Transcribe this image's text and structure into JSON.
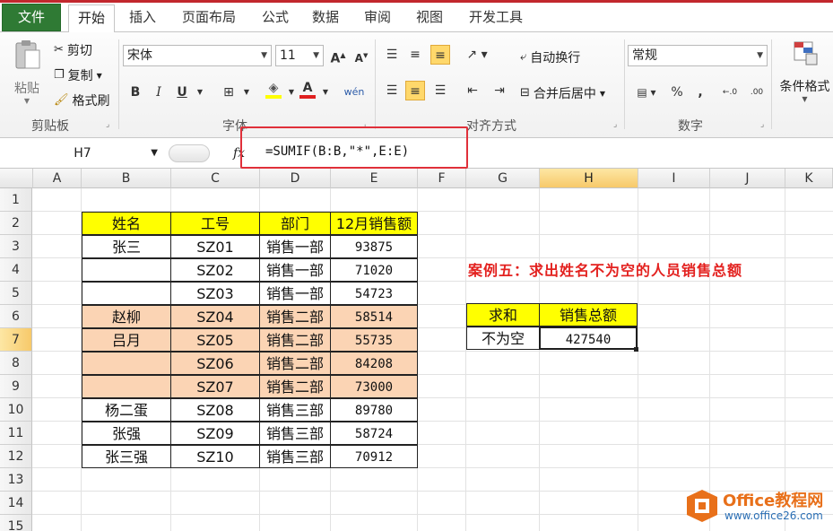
{
  "tabs": [
    "文件",
    "开始",
    "插入",
    "页面布局",
    "公式",
    "数据",
    "审阅",
    "视图",
    "开发工具"
  ],
  "ribbon": {
    "clipboard": {
      "paste": "粘贴",
      "cut": "剪切",
      "copy": "复制",
      "format_painter": "格式刷",
      "label": "剪贴板"
    },
    "font": {
      "name": "宋体",
      "size": "11",
      "label": "字体",
      "bold": "B",
      "italic": "I",
      "underline": "U",
      "grow": "A",
      "shrink": "A",
      "color_a": "A",
      "phonetic": "wén"
    },
    "alignment": {
      "wrap": "自动换行",
      "merge": "合并后居中",
      "label": "对齐方式"
    },
    "number": {
      "format": "常规",
      "percent": "%",
      "comma": ",",
      "label": "数字",
      "inc_dec": "←.0",
      "dec_dec": ".00"
    },
    "styles": {
      "conditional": "条件格式"
    }
  },
  "formula_bar": {
    "name_box": "H7",
    "fx": "fx",
    "formula": "=SUMIF(B:B,\"*\",E:E)"
  },
  "columns": [
    "A",
    "B",
    "C",
    "D",
    "E",
    "F",
    "G",
    "H",
    "I",
    "J",
    "K"
  ],
  "rows": [
    "1",
    "2",
    "3",
    "4",
    "5",
    "6",
    "7",
    "8",
    "9",
    "10",
    "11",
    "12",
    "13",
    "14",
    "15"
  ],
  "table": {
    "headers": [
      "姓名",
      "工号",
      "部门",
      "12月销售额"
    ],
    "rows": [
      [
        "张三",
        "SZ01",
        "销售一部",
        "93875"
      ],
      [
        "",
        "SZ02",
        "销售一部",
        "71020"
      ],
      [
        "",
        "SZ03",
        "销售一部",
        "54723"
      ],
      [
        "赵柳",
        "SZ04",
        "销售二部",
        "58514"
      ],
      [
        "吕月",
        "SZ05",
        "销售二部",
        "55735"
      ],
      [
        "",
        "SZ06",
        "销售二部",
        "84208"
      ],
      [
        "",
        "SZ07",
        "销售二部",
        "73000"
      ],
      [
        "杨二蛋",
        "SZ08",
        "销售三部",
        "89780"
      ],
      [
        "张强",
        "SZ09",
        "销售三部",
        "58724"
      ],
      [
        "张三强",
        "SZ10",
        "销售三部",
        "70912"
      ]
    ]
  },
  "note": "案例五：求出姓名不为空的人员销售总额",
  "summary": {
    "h1": "求和",
    "h2": "销售总额",
    "label": "不为空",
    "value": "427540"
  },
  "watermark": {
    "title": "Office教程网",
    "url": "www.office26.com"
  },
  "colors": {
    "header_yellow": "#ffff00",
    "pink": "#fbd4b4",
    "note_red": "#e3211f",
    "file_green": "#2f7a34"
  }
}
